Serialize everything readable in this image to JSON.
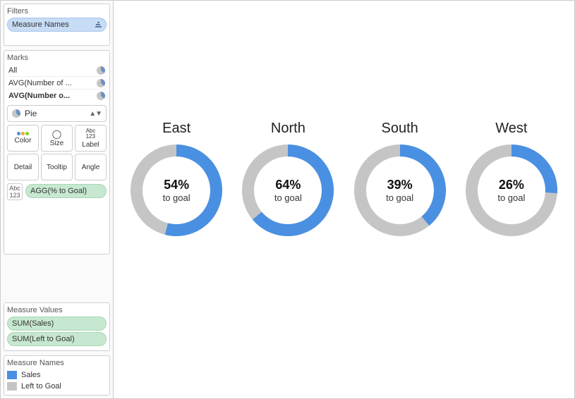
{
  "colors": {
    "sales": "#4a90e2",
    "left_to_goal": "#c5c5c5"
  },
  "sidebar": {
    "filters": {
      "title": "Filters",
      "pill": "Measure Names"
    },
    "marks": {
      "title": "Marks",
      "rows": [
        {
          "label": "All",
          "bold": false
        },
        {
          "label": "AVG(Number of ...",
          "bold": false
        },
        {
          "label": "AVG(Number o...",
          "bold": true
        }
      ],
      "mark_type": "Pie",
      "shelves": {
        "color": "Color",
        "size": "Size",
        "label": "Label",
        "detail": "Detail",
        "tooltip": "Tooltip",
        "angle": "Angle"
      },
      "label_pill": "AGG(% to Goal)"
    },
    "measure_values": {
      "title": "Measure Values",
      "pills": [
        "SUM(Sales)",
        "SUM(Left to Goal)"
      ]
    },
    "legend": {
      "title": "Measure Names",
      "items": [
        {
          "label": "Sales",
          "color_key": "sales"
        },
        {
          "label": "Left to Goal",
          "color_key": "left_to_goal"
        }
      ]
    }
  },
  "chart_data": {
    "type": "pie",
    "title": "",
    "subtitle_each": "to goal",
    "series_names": [
      "Sales",
      "Left to Goal"
    ],
    "donuts": [
      {
        "region": "East",
        "pct_to_goal": 54
      },
      {
        "region": "North",
        "pct_to_goal": 64
      },
      {
        "region": "South",
        "pct_to_goal": 39
      },
      {
        "region": "West",
        "pct_to_goal": 26
      }
    ]
  }
}
